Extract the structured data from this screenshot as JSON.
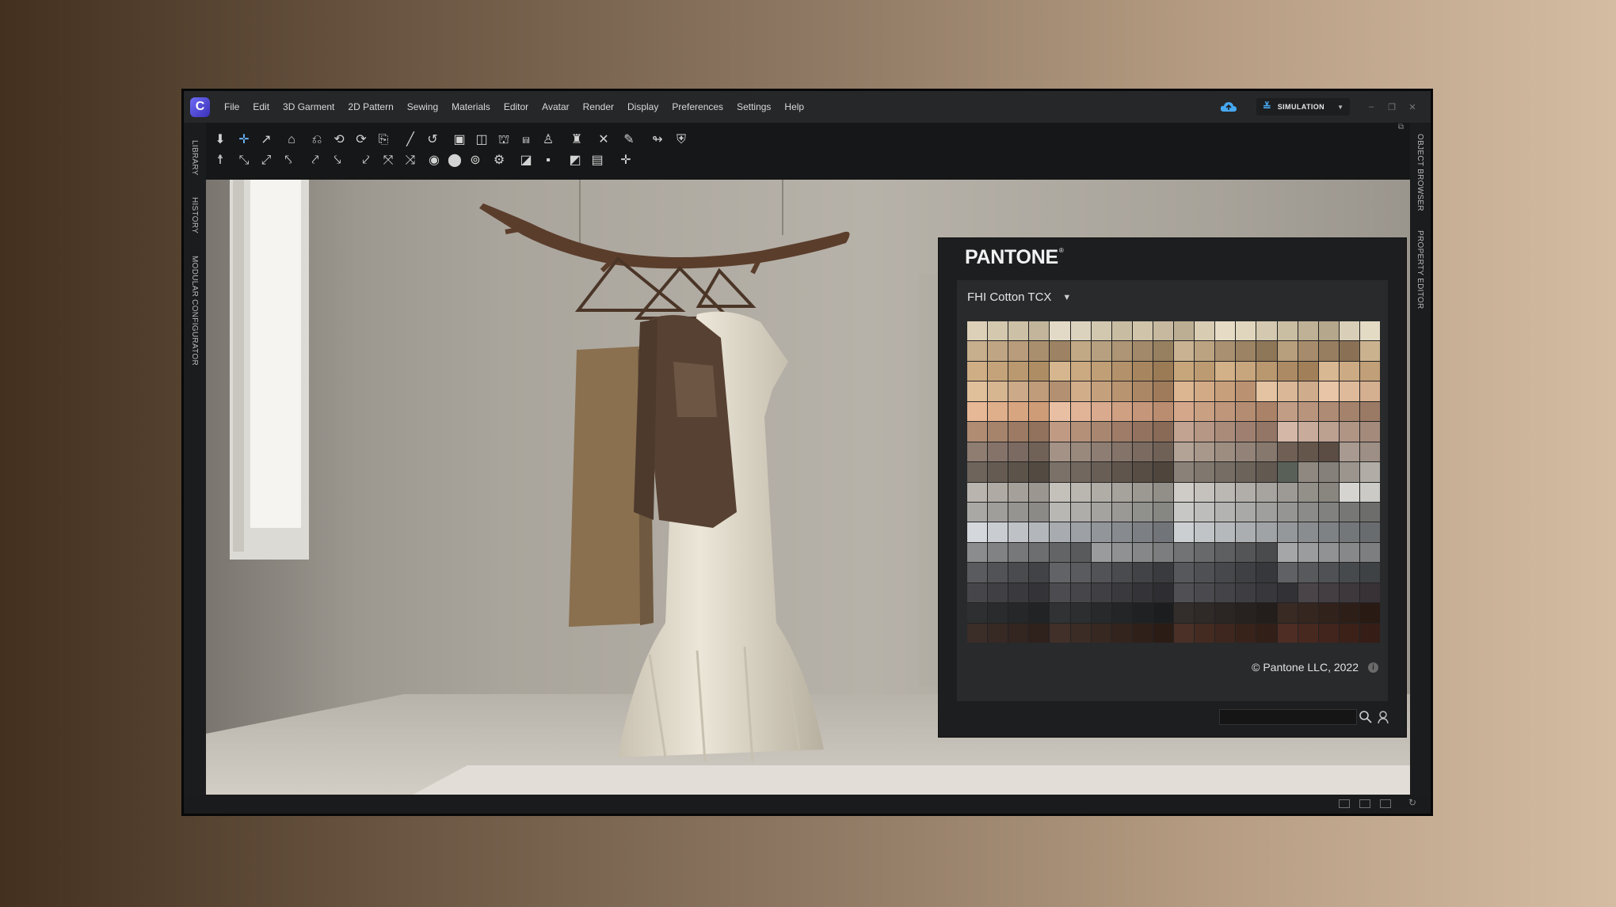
{
  "app": {
    "logo_glyph": "C",
    "menu": [
      "File",
      "Edit",
      "3D Garment",
      "2D Pattern",
      "Sewing",
      "Materials",
      "Editor",
      "Avatar",
      "Render",
      "Display",
      "Preferences",
      "Settings",
      "Help"
    ],
    "simulation_label": "SIMULATION",
    "accent_color": "#47a8f2"
  },
  "left_tabs": [
    "LIBRARY",
    "HISTORY",
    "MODULAR CONFIGURATOR"
  ],
  "right_tabs": [
    "OBJECT BROWSER",
    "PROPERTY EDITOR"
  ],
  "icons": {
    "window_controls": [
      "minimize-icon",
      "restore-icon",
      "close-icon"
    ],
    "toolbar": "3d-garment-tool-icons",
    "status_bar": [
      "single-view-icon",
      "split-view-icon",
      "quad-view-icon",
      "refresh-icon"
    ]
  },
  "pantone": {
    "brand": "PANTONE",
    "brand_mark": "®",
    "library": "FHI Cotton TCX",
    "copyright": "© Pantone LLC, 2022",
    "info_glyph": "i",
    "search_value": "",
    "swatch_palette": {
      "columns": 20,
      "rows": [
        [
          "#dcd0b8",
          "#d4c8af",
          "#ccc0a6",
          "#c2b59b",
          "#e2dac6",
          "#dcd3bf",
          "#d2c8b0",
          "#c8bca2",
          "#d0c4aa",
          "#c6b99f",
          "#bcae93",
          "#d8ccb3",
          "#e6dcc6",
          "#e0d5bd",
          "#d4c9b0",
          "#c9bda2",
          "#bfb196",
          "#b5a78b",
          "#d9cfb8",
          "#e4dbc5"
        ],
        [
          "#c7ae8c",
          "#bfa584",
          "#b89c7b",
          "#aa8f6f",
          "#9d8363",
          "#c2a986",
          "#b6a07f",
          "#ad9575",
          "#a2896a",
          "#968060",
          "#c9b292",
          "#bba381",
          "#a99070",
          "#9b8363",
          "#8e7658",
          "#b79e7c",
          "#a68c6c",
          "#977e60",
          "#8a7155",
          "#cbb28f"
        ],
        [
          "#cfae85",
          "#c5a37a",
          "#bb9970",
          "#af8d64",
          "#d6b68e",
          "#cba981",
          "#c09e76",
          "#b3916a",
          "#a7865f",
          "#9b7b56",
          "#c8a67c",
          "#bd9b72",
          "#d2b088",
          "#c7a57d",
          "#b9976f",
          "#ac8a63",
          "#a07f59",
          "#d8b892",
          "#ccab84",
          "#c19f78"
        ],
        [
          "#e0bf9b",
          "#d6b591",
          "#cca988",
          "#c09c7b",
          "#b39071",
          "#d1ad8a",
          "#c5a07d",
          "#b89471",
          "#ab8765",
          "#9f7b5b",
          "#dcb591",
          "#d3aa86",
          "#c89f7b",
          "#bb9271",
          "#e4c3a2",
          "#dab797",
          "#cfac8c",
          "#e8c5a6",
          "#deba9b",
          "#d4af90"
        ],
        [
          "#e7b896",
          "#dfae8b",
          "#d8a581",
          "#cf9c78",
          "#e9bfa3",
          "#e1b498",
          "#d9aa8d",
          "#d0a083",
          "#c59679",
          "#bb8d70",
          "#d5a78a",
          "#caa083",
          "#bf967a",
          "#b48c71",
          "#aa8268",
          "#c19d86",
          "#b8947d",
          "#ae8b74",
          "#a4826c",
          "#9a7a64"
        ],
        [
          "#b08c73",
          "#a6836b",
          "#9c7a63",
          "#92725c",
          "#c09a82",
          "#b49079",
          "#a98670",
          "#9e7c67",
          "#93735f",
          "#886a57",
          "#c2a290",
          "#b69684",
          "#aa8b7a",
          "#9f8070",
          "#937666",
          "#d4b7a6",
          "#c8ab9b",
          "#bca090",
          "#b09585",
          "#a48a7b"
        ],
        [
          "#8f7d72",
          "#85736a",
          "#7b6a61",
          "#716258",
          "#a49286",
          "#99887c",
          "#8e7d72",
          "#847368",
          "#7a6a5f",
          "#706157",
          "#b3a396",
          "#a8988b",
          "#9d8d81",
          "#928277",
          "#87786d",
          "#6f5f55",
          "#65564c",
          "#5b4d44",
          "#a89a90",
          "#9d8f85"
        ],
        [
          "#6e645b",
          "#655b52",
          "#5c534a",
          "#534a42",
          "#7c7168",
          "#72675e",
          "#695e55",
          "#60554c",
          "#574d44",
          "#4f453d",
          "#8a8178",
          "#80776e",
          "#766d64",
          "#6c635a",
          "#625951",
          "#596058",
          "#8f8880",
          "#85807a",
          "#9b958e",
          "#b1aca6"
        ],
        [
          "#b9b4ad",
          "#afaaa3",
          "#a5a099",
          "#9b968f",
          "#c4c0ba",
          "#bab6b0",
          "#b0aca6",
          "#a6a29c",
          "#9c9892",
          "#928e88",
          "#cfccc7",
          "#c5c2bd",
          "#bbb8b3",
          "#b1aea9",
          "#a7a49f",
          "#9d9a95",
          "#939089",
          "#89867f",
          "#d6d4d0",
          "#cccac6"
        ],
        [
          "#a9a8a5",
          "#9f9e9b",
          "#959491",
          "#8b8a87",
          "#b8b7b4",
          "#aeadaa",
          "#a4a3a0",
          "#9a9996",
          "#90908d",
          "#868683",
          "#c7c7c5",
          "#bdbdbb",
          "#b3b3b1",
          "#a9a9a7",
          "#9f9f9d",
          "#959593",
          "#8b8b89",
          "#818180",
          "#777776",
          "#6d6d6c"
        ],
        [
          "#d4d8dc",
          "#c9cdd1",
          "#bec2c6",
          "#b3b7bb",
          "#a8acb0",
          "#9da1a5",
          "#92969a",
          "#878b8f",
          "#7c8084",
          "#717579",
          "#cccfd1",
          "#c1c4c6",
          "#b6b9bb",
          "#abaeb0",
          "#a0a3a5",
          "#95989a",
          "#8a8d8f",
          "#7f8284",
          "#74777a",
          "#696c6f"
        ],
        [
          "#8a8c8e",
          "#808284",
          "#76787a",
          "#6c6e70",
          "#626466",
          "#585a5c",
          "#9a9b9c",
          "#909192",
          "#868788",
          "#7c7d7e",
          "#727374",
          "#68696a",
          "#5e5f60",
          "#545556",
          "#4a4b4c",
          "#a5a6a7",
          "#9b9c9d",
          "#919293",
          "#878889",
          "#7d7e7f"
        ],
        [
          "#5a5b5e",
          "#525356",
          "#4a4b4e",
          "#424346",
          "#626366",
          "#5a5b5e",
          "#525356",
          "#4a4b4e",
          "#424346",
          "#3a3b3e",
          "#56585c",
          "#4e5054",
          "#46484c",
          "#3e4044",
          "#36383c",
          "#5f6164",
          "#57595c",
          "#4f5154",
          "#474a4d",
          "#3f4245"
        ],
        [
          "#46464a",
          "#404044",
          "#3a3a3e",
          "#343438",
          "#4c4b4f",
          "#464549",
          "#403f43",
          "#3a393d",
          "#343337",
          "#2e2d31",
          "#505054",
          "#4a4a4e",
          "#444448",
          "#3e3e42",
          "#38383c",
          "#323236",
          "#4a4449",
          "#443e43",
          "#3e383d",
          "#383237"
        ],
        [
          "#2e2f31",
          "#2a2b2d",
          "#262729",
          "#222325",
          "#303234",
          "#2c2e30",
          "#28292b",
          "#242527",
          "#202123",
          "#1c1d1f",
          "#332d2b",
          "#2f2927",
          "#2b2523",
          "#27211f",
          "#231d1b",
          "#3a2a24",
          "#362620",
          "#32221c",
          "#2e1e18",
          "#2a1a14"
        ],
        [
          "#3b2d28",
          "#372924",
          "#332520",
          "#2f211c",
          "#413029",
          "#3c2c26",
          "#382822",
          "#34241e",
          "#30201a",
          "#2c1c16",
          "#4a3026",
          "#442b22",
          "#3e271f",
          "#38231b",
          "#321f18",
          "#4e2d24",
          "#482920",
          "#42251d",
          "#3c2119",
          "#361d16"
        ]
      ]
    }
  }
}
